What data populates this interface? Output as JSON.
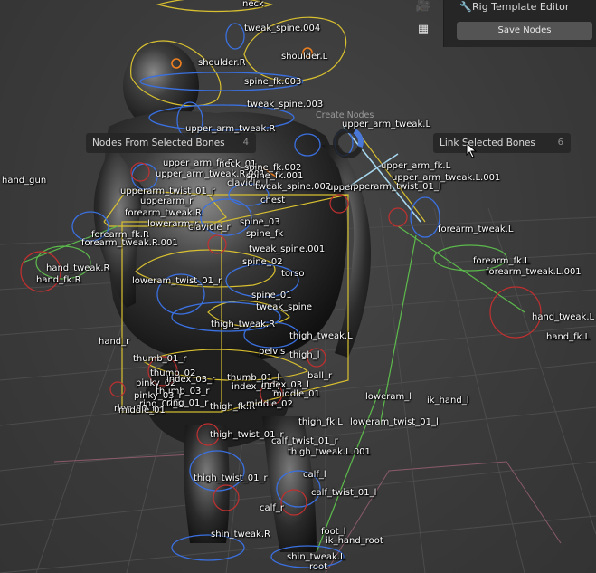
{
  "header": {
    "panel_title": "Rig Template Editor",
    "save_button": "Save Nodes"
  },
  "pie_menu": {
    "title": "Create Nodes",
    "left_item": {
      "label": "Nodes From Selected Bones",
      "count": "4"
    },
    "right_item": {
      "label": "Link Selected Bones",
      "count": "6"
    }
  },
  "bone_labels": {
    "neck": "neck",
    "tweak_spine_004": "tweak_spine.004",
    "shoulder_r": "shoulder.R",
    "shoulder_l": "shoulder.L",
    "spine_fk_003": "spine_fk.003",
    "tweak_spine_003": "tweak_spine.003",
    "upper_arm_tweak_r_top": "upper_arm_tweak.R",
    "upper_arm_tweak_l": "upper_arm_tweak.L",
    "upper_arm_fk_r": "upper_arm_fk.R",
    "neck_01": "neck_01",
    "spine_fk_002": "spine_fk.002",
    "upper_arm_tweak_r_001": "upper_arm_tweak.R.001",
    "spine_fk_001": "spine_fk.001",
    "upper_arm_fk_l": "upper_arm_fk.L",
    "upper_arm_tweak_l_001": "upper_arm_tweak.L.001",
    "hand_gun": "hand_gun",
    "clavicle_l": "clavicle_l",
    "upperarm_twist_01_r": "upperarm_twist_01_r",
    "tweak_spine_002": "tweak_spine.002",
    "upperarm_twist_01_l": "upperarm_twist_01_l",
    "upperarm_l_partial": "upper",
    "upperarm_r": "upperarm_r",
    "chest": "chest",
    "forearm_tweak_r": "forearm_tweak.R",
    "lowerarm_r": "lowerarm_r",
    "clavicle_r": "clavicle_r",
    "spine_03": "spine_03",
    "forearm_tweak_l": "forearm_tweak.L",
    "forearm_fk_r": "forearm_fk.R",
    "spine_fk": "spine_fk",
    "forearm_tweak_r_001": "forearm_tweak.R.001",
    "tweak_spine_001": "tweak_spine.001",
    "spine_02": "spine_02",
    "forearm_fk_l": "forearm_fk.L",
    "hand_tweak_r": "hand_tweak.R",
    "torso": "torso",
    "forearm_tweak_l_001": "forearm_tweak.L.001",
    "hand_fk_r": "hand_fk.R",
    "lowerarm_twist_01_r": "loweram_twist_01_r",
    "spine_01": "spine_01",
    "tweak_spine": "tweak_spine",
    "hand_tweak_l": "hand_tweak.L",
    "thigh_tweak_r": "thigh_tweak.R",
    "thigh_tweak_l": "thigh_tweak.L",
    "hand_fk_l": "hand_fk.L",
    "hand_r": "hand_r",
    "pelvis": "pelvis",
    "thigh_l": "thigh_l",
    "thumb_01_r": "thumb_01_r",
    "thumb_02": "thumb_02",
    "pinky_02": "pinky_02",
    "index_03_r": "index_03_r",
    "thumb_03_r": "thumb_03_r",
    "thumb_01_l": "thumb_01_l",
    "ball_r": "ball_r",
    "index_02_r": "index_02_l",
    "index_03_l": "index_03_l",
    "middle_01_r": "middle_01",
    "lowerarm_l": "loweram_l",
    "ik_hand_l": "ik_hand_l",
    "pinky_03_r": "pinky_03_r",
    "ring_02_r": "ring_02_r",
    "ring_01_r": "ring_01_r",
    "ring_03_r": "ring_03_r",
    "middle_01": "middle_01",
    "thigh_fk_r": "thigh_fk.R",
    "middle_02_l": "middle_02",
    "thigh_fk_l": "thigh_fk.L",
    "lowerarm_twist_01_l": "loweram_twist_01_l",
    "thigh_twist_01_r": "thigh_twist_01_r",
    "calf_twist_01_r": "calf_twist_01_r",
    "thigh_tweak_l_001": "thigh_tweak.L.001",
    "calf_l": "calf_l",
    "calf_twist_01_l": "calf_twist_01_l",
    "thigh_twist_01_r_low": "thigh_twist_01_r",
    "calf_r": "calf_r",
    "foot_l": "foot_l",
    "ik_hand_root": "ik_hand_root",
    "shin_tweak_r": "shin_tweak.R",
    "shin_tweak_l": "shin_tweak.L",
    "root": "root"
  }
}
